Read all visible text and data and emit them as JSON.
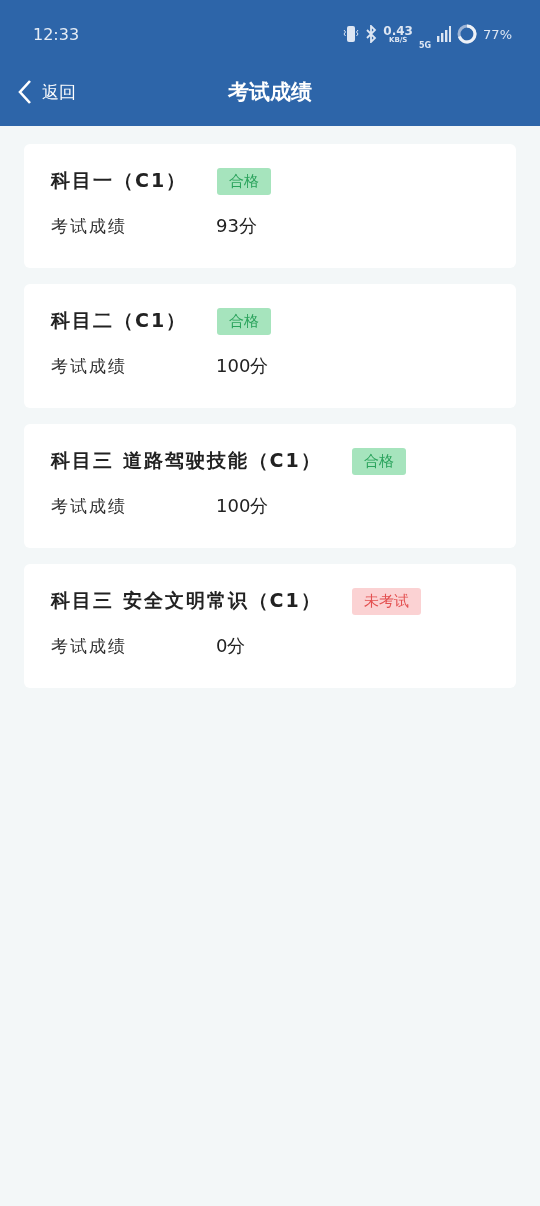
{
  "status_bar": {
    "time": "12:33",
    "speed": "0.43",
    "speed_unit": "KB/S",
    "network": "5G",
    "battery": "77%"
  },
  "nav": {
    "back": "返回",
    "title": "考试成绩"
  },
  "subjects": [
    {
      "name": "科目一（C1）",
      "status": "合格",
      "kind": "passed",
      "score_label": "考试成绩",
      "score": "93分"
    },
    {
      "name": "科目二（C1）",
      "status": "合格",
      "kind": "passed",
      "score_label": "考试成绩",
      "score": "100分"
    },
    {
      "name": "科目三 道路驾驶技能（C1）",
      "status": "合格",
      "kind": "passed",
      "score_label": "考试成绩",
      "score": "100分"
    },
    {
      "name": "科目三 安全文明常识（C1）",
      "status": "未考试",
      "kind": "not_taken",
      "score_label": "考试成绩",
      "score": "0分"
    }
  ]
}
